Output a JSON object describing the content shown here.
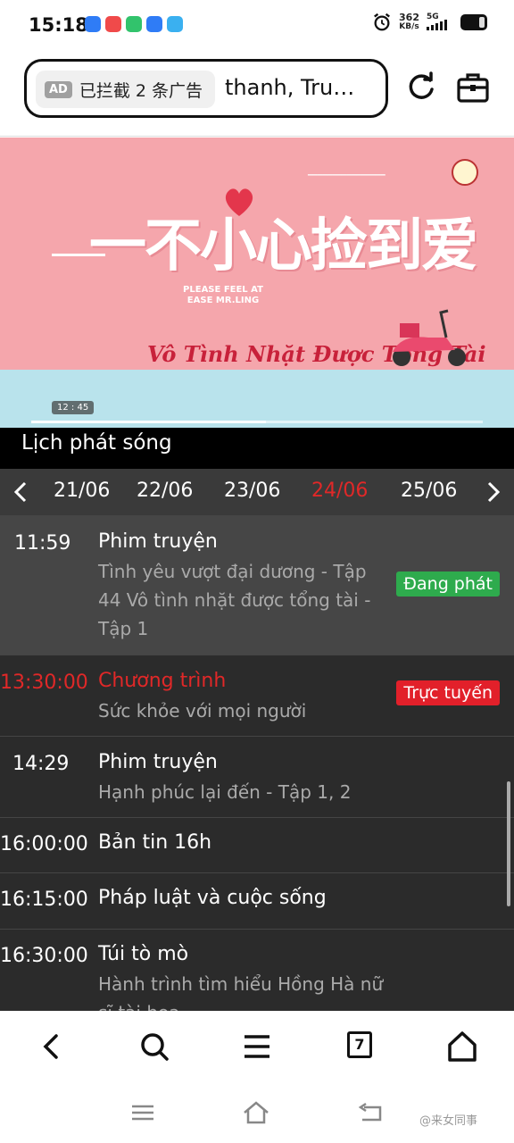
{
  "status_bar": {
    "time": "15:18",
    "net_speed_value": "362",
    "net_speed_unit": "KB/s",
    "signal_label": "5G",
    "app_icon_colors": [
      "#2f7cf6",
      "#f04a4a",
      "#32c36c",
      "#2f7cf6",
      "#3ab0f0"
    ]
  },
  "address_bar": {
    "ad_badge": "AD",
    "ad_text": "已拦截 2 条广告",
    "url_text": "thanh, Tru…",
    "reload_icon": "reload-icon",
    "toolbox_icon": "toolbox-icon"
  },
  "video": {
    "title_cn": "一不小心捡到爱",
    "subtitle_en": "PLEASE FEEL AT EASE MR.LING",
    "subtitle_vi": "Vô Tình Nhặt Được Tổng Tài",
    "timestamp": "12 : 45",
    "progress": 0.52
  },
  "schedule": {
    "heading": "Lịch phát sóng",
    "dates": [
      "21/06",
      "22/06",
      "23/06",
      "24/06",
      "25/06"
    ],
    "selected_date": "24/06",
    "selected_color": "#e02828",
    "programs": [
      {
        "time": "11:59",
        "title": "Phim truyện",
        "desc": "Tình yêu vượt đại dương - Tập 44 Vô tình nhặt được tổng tài - Tập 1",
        "badge": "Đang phát",
        "state": "current"
      },
      {
        "time": "13:30:00",
        "title": "Chương trình",
        "desc": "Sức khỏe với mọi người",
        "badge": "Trực tuyến",
        "state": "live"
      },
      {
        "time": "14:29",
        "title": "Phim truyện",
        "desc": "Hạnh phúc lại đến - Tập 1, 2"
      },
      {
        "time": "16:00:00",
        "title": "Bản tin 16h"
      },
      {
        "time": "16:15:00",
        "title": "Pháp luật và cuộc sống"
      },
      {
        "time": "16:30:00",
        "title": "Túi tò mò",
        "desc": "Hành trình tìm hiểu Hồng Hà nữ sĩ tài hoa"
      }
    ]
  },
  "browser_nav": {
    "tab_count": "7"
  },
  "watermark": "@来女同事"
}
